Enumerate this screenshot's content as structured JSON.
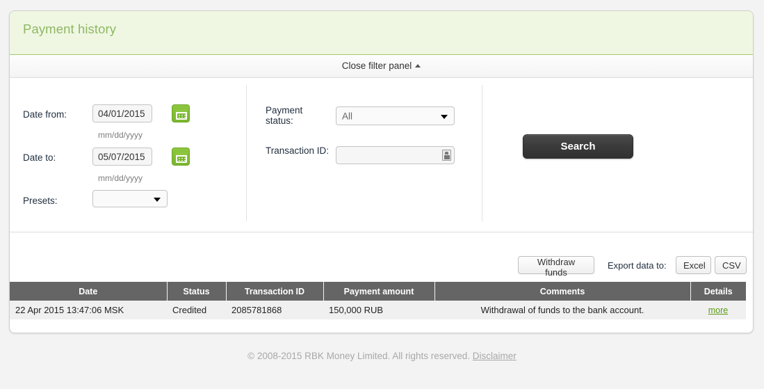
{
  "header": {
    "title": "Payment history"
  },
  "filter_bar": {
    "toggle_label": "Close filter panel"
  },
  "filters": {
    "date_from": {
      "label": "Date from:",
      "value": "04/01/2015",
      "hint": "mm/dd/yyyy",
      "calendar_icon": "calendar-icon"
    },
    "date_to": {
      "label": "Date to:",
      "value": "05/07/2015",
      "hint": "mm/dd/yyyy",
      "calendar_icon": "calendar-icon"
    },
    "presets": {
      "label": "Presets:",
      "value": ""
    },
    "payment_status": {
      "label": "Payment status:",
      "value": "All"
    },
    "transaction_id": {
      "label": "Transaction ID:",
      "value": "",
      "placeholder": "",
      "picker_icon": "contact-picker-icon"
    },
    "search_button": "Search"
  },
  "actions": {
    "withdraw_funds": "Withdraw funds",
    "export_label": "Export data to:",
    "export_excel": "Excel",
    "export_csv": "CSV"
  },
  "table": {
    "columns": [
      "Date",
      "Status",
      "Transaction ID",
      "Payment amount",
      "Comments",
      "Details"
    ],
    "rows": [
      {
        "date": "22 Apr 2015 13:47:06 MSK",
        "status": "Credited",
        "transaction_id": "2085781868",
        "amount": "150,000 RUB",
        "comments": "Withdrawal of funds to the bank account.",
        "details": "more"
      }
    ]
  },
  "footer": {
    "copyright": "© 2008-2015 RBK Money Limited. All rights reserved.",
    "disclaimer": "Disclaimer"
  },
  "colors": {
    "header_bg": "#eff7e2",
    "header_text": "#8fb764",
    "header_border": "#9fc96a",
    "accent_green": "#7ab62e",
    "link_green": "#5a9a16",
    "table_header_bg": "#656565",
    "search_button_bg": "#3a3a3a"
  }
}
